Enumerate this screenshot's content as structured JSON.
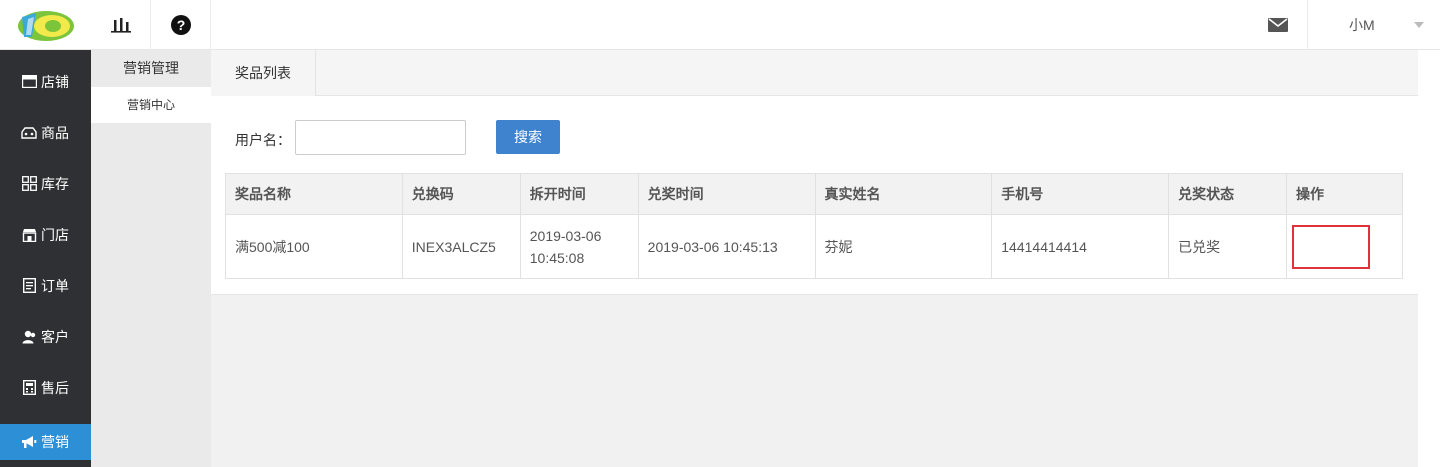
{
  "header": {
    "chart_icon": "bar-chart-icon",
    "help_icon": "question-circle-icon",
    "mail_icon": "envelope-icon",
    "username": "小M"
  },
  "sidebar": {
    "items": [
      {
        "label": "店铺",
        "icon": "store-icon"
      },
      {
        "label": "商品",
        "icon": "goods-icon"
      },
      {
        "label": "库存",
        "icon": "grid-icon"
      },
      {
        "label": "门店",
        "icon": "shop-icon"
      },
      {
        "label": "订单",
        "icon": "order-icon"
      },
      {
        "label": "客户",
        "icon": "user-icon"
      },
      {
        "label": "售后",
        "icon": "calculator-icon"
      },
      {
        "label": "营销",
        "icon": "megaphone-icon"
      }
    ]
  },
  "subnav": {
    "title": "营销管理",
    "item": "营销中心"
  },
  "main": {
    "tab": "奖品列表",
    "search": {
      "label": "用户名：",
      "value": "",
      "button": "搜索"
    },
    "table": {
      "headers": [
        "奖品名称",
        "兑换码",
        "拆开时间",
        "兑奖时间",
        "真实姓名",
        "手机号",
        "兑奖状态",
        "操作"
      ],
      "rows": [
        [
          "满500减100",
          "INEX3ALCZ5",
          "2019-03-06 10:45:08",
          "2019-03-06 10:45:13",
          "芬妮",
          "14414414414",
          "已兑奖",
          ""
        ]
      ]
    }
  },
  "colors": {
    "sidebar_bg": "#2f3033",
    "active_bg": "#2d8fd5",
    "button_bg": "#3f82ce",
    "highlight_border": "#e0323b"
  }
}
